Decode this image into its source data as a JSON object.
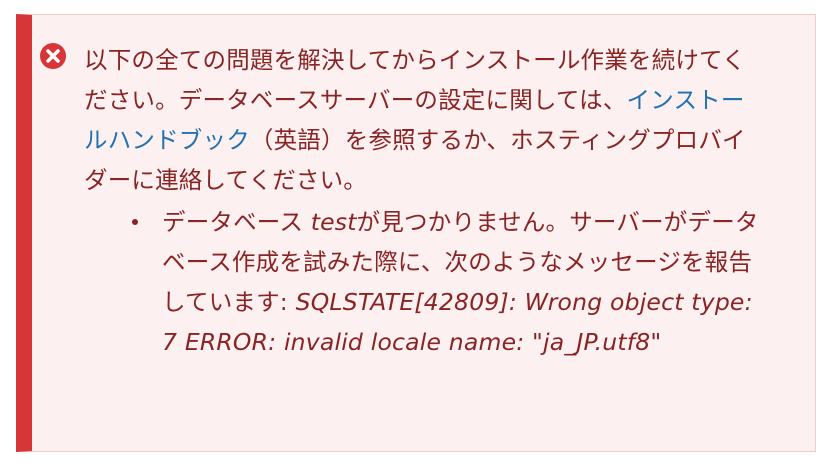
{
  "notice": {
    "icon": "error-circle-x-icon",
    "colors": {
      "background": "#fcf0f1",
      "accent": "#d63638",
      "text": "#8a2424",
      "link": "#2271b1"
    },
    "message": {
      "part1": "以下の全ての問題を解決してからインストール作業を続けてください。データベースサーバーの設定に関しては、",
      "link_text": "インストールハンドブック",
      "part2": "（英語）を参照するか、ホスティングプロバイダーに連絡してください。"
    },
    "errors": [
      {
        "prefix": "データベース ",
        "db_name": "test",
        "middle": "が見つかりません。サーバーがデータベース作成を試みた際に、次のようなメッセージを報告しています: ",
        "detail": "SQLSTATE[42809]: Wrong object type: 7 ERROR: invalid locale name: \"ja_JP.utf8\""
      }
    ]
  }
}
